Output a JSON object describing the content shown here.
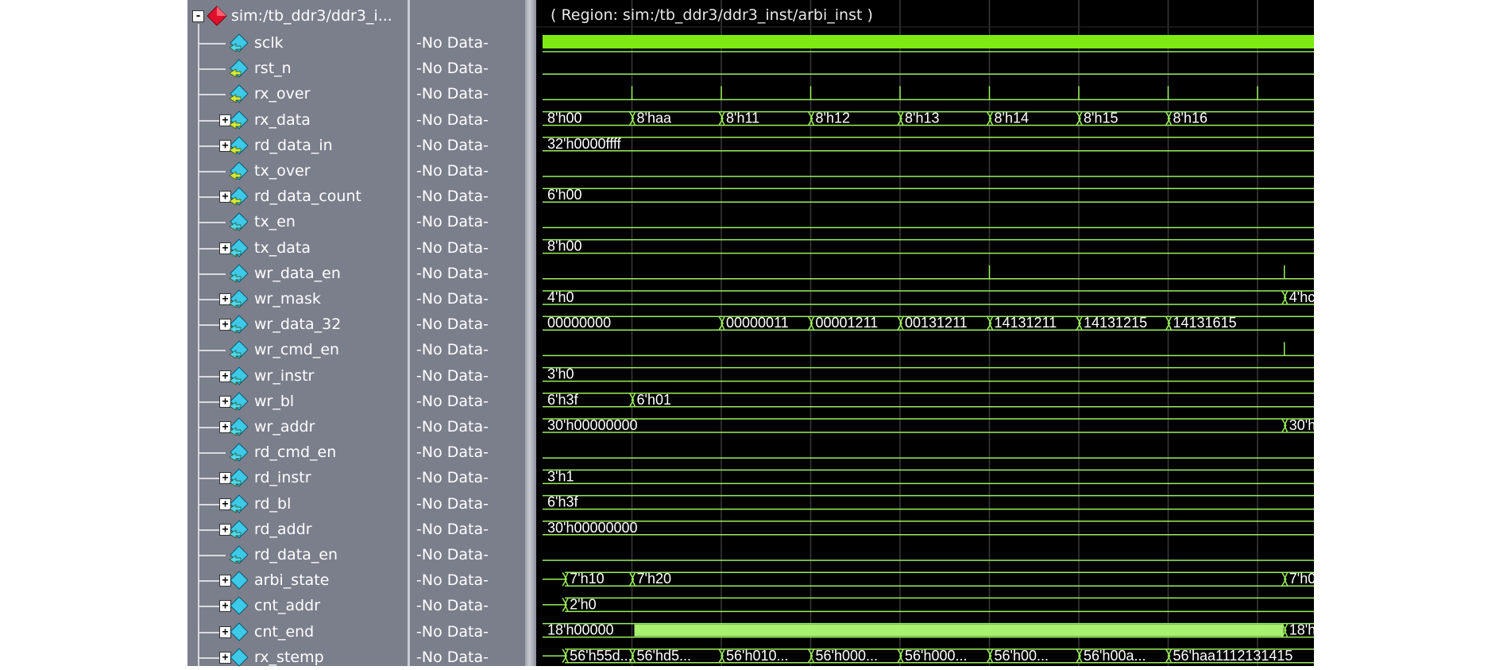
{
  "region_label": "( Region: sim:/tb_ddr3/ddr3_inst/arbi_inst )",
  "root": {
    "label": "sim:/tb_ddr3/ddr3_i...",
    "expander": "-"
  },
  "no_data": "-No Data-",
  "signals": [
    {
      "name": "sclk",
      "bus": false,
      "icon": "cyan"
    },
    {
      "name": "rst_n",
      "bus": false,
      "icon": "yellow-green"
    },
    {
      "name": "rx_over",
      "bus": false,
      "icon": "yellow-green"
    },
    {
      "name": "rx_data",
      "bus": true,
      "icon": "yellow-green"
    },
    {
      "name": "rd_data_in",
      "bus": true,
      "icon": "yellow-green"
    },
    {
      "name": "tx_over",
      "bus": false,
      "icon": "yellow-green"
    },
    {
      "name": "rd_data_count",
      "bus": true,
      "icon": "yellow-green"
    },
    {
      "name": "tx_en",
      "bus": false,
      "icon": "cyan"
    },
    {
      "name": "tx_data",
      "bus": true,
      "icon": "cyan"
    },
    {
      "name": "wr_data_en",
      "bus": false,
      "icon": "cyan"
    },
    {
      "name": "wr_mask",
      "bus": true,
      "icon": "cyan"
    },
    {
      "name": "wr_data_32",
      "bus": true,
      "icon": "cyan"
    },
    {
      "name": "wr_cmd_en",
      "bus": false,
      "icon": "cyan"
    },
    {
      "name": "wr_instr",
      "bus": true,
      "icon": "cyan"
    },
    {
      "name": "wr_bl",
      "bus": true,
      "icon": "cyan"
    },
    {
      "name": "wr_addr",
      "bus": true,
      "icon": "cyan"
    },
    {
      "name": "rd_cmd_en",
      "bus": false,
      "icon": "cyan"
    },
    {
      "name": "rd_instr",
      "bus": true,
      "icon": "cyan"
    },
    {
      "name": "rd_bl",
      "bus": true,
      "icon": "cyan"
    },
    {
      "name": "rd_addr",
      "bus": true,
      "icon": "cyan"
    },
    {
      "name": "rd_data_en",
      "bus": false,
      "icon": "cyan"
    },
    {
      "name": "arbi_state",
      "bus": true,
      "icon": "plain-cyan"
    },
    {
      "name": "cnt_addr",
      "bus": true,
      "icon": "plain-cyan"
    },
    {
      "name": "cnt_end",
      "bus": true,
      "icon": "plain-cyan"
    },
    {
      "name": "rx_stemp",
      "bus": true,
      "icon": "plain-cyan"
    }
  ],
  "waves": [
    {
      "kind": "clock"
    },
    {
      "kind": "flat"
    },
    {
      "kind": "pulses",
      "pulses": [
        1,
        2,
        3,
        4,
        5,
        6,
        7,
        8
      ]
    },
    {
      "kind": "bus",
      "segs": [
        [
          0,
          "8'h00"
        ],
        [
          1,
          "8'haa"
        ],
        [
          2,
          "8'h11"
        ],
        [
          3,
          "8'h12"
        ],
        [
          4,
          "8'h13"
        ],
        [
          5,
          "8'h14"
        ],
        [
          6,
          "8'h15"
        ],
        [
          7,
          "8'h16"
        ]
      ]
    },
    {
      "kind": "bus",
      "segs": [
        [
          0,
          "32'h0000ffff"
        ]
      ]
    },
    {
      "kind": "flat"
    },
    {
      "kind": "bus",
      "segs": [
        [
          0,
          "6'h00"
        ]
      ]
    },
    {
      "kind": "flat"
    },
    {
      "kind": "bus",
      "segs": [
        [
          0,
          "8'h00"
        ]
      ]
    },
    {
      "kind": "pulses",
      "pulses": [
        5,
        8.3
      ]
    },
    {
      "kind": "bus",
      "segs": [
        [
          0,
          "4'h0"
        ],
        [
          8.3,
          "4'hc"
        ]
      ]
    },
    {
      "kind": "bus",
      "segs": [
        [
          0,
          "00000000"
        ],
        [
          2,
          "00000011"
        ],
        [
          3,
          "00001211"
        ],
        [
          4,
          "00131211"
        ],
        [
          5,
          "14131211"
        ],
        [
          6,
          "14131215"
        ],
        [
          7,
          "14131615"
        ]
      ]
    },
    {
      "kind": "pulses",
      "pulses": [
        8.3
      ]
    },
    {
      "kind": "bus",
      "segs": [
        [
          0,
          "3'h0"
        ]
      ]
    },
    {
      "kind": "bus",
      "segs": [
        [
          0,
          "6'h3f"
        ],
        [
          1,
          "6'h01"
        ]
      ]
    },
    {
      "kind": "bus",
      "segs": [
        [
          0,
          "30'h00000000"
        ],
        [
          8.3,
          "30'h"
        ]
      ]
    },
    {
      "kind": "flat"
    },
    {
      "kind": "bus",
      "segs": [
        [
          0,
          "3'h1"
        ]
      ]
    },
    {
      "kind": "bus",
      "segs": [
        [
          0,
          "6'h3f"
        ]
      ]
    },
    {
      "kind": "bus",
      "segs": [
        [
          0,
          "30'h00000000"
        ]
      ]
    },
    {
      "kind": "flat"
    },
    {
      "kind": "bus",
      "segs": [
        [
          0.25,
          "7'h10"
        ],
        [
          1,
          "7'h20"
        ],
        [
          8.3,
          "7'h0"
        ]
      ]
    },
    {
      "kind": "bus",
      "segs": [
        [
          0.25,
          "2'h0"
        ]
      ]
    },
    {
      "kind": "fillbus",
      "segs": [
        [
          0,
          "18'h00000"
        ],
        [
          8.3,
          "18'h"
        ]
      ],
      "fill": [
        1,
        8.3
      ]
    },
    {
      "kind": "bus",
      "segs": [
        [
          0.25,
          "56'h55d..."
        ],
        [
          1,
          "56'hd5..."
        ],
        [
          2,
          "56'h010..."
        ],
        [
          3,
          "56'h000..."
        ],
        [
          4,
          "56'h000..."
        ],
        [
          5,
          "56'h00..."
        ],
        [
          6,
          "56'h00a..."
        ],
        [
          7,
          "56'haa1112131415"
        ]
      ]
    }
  ],
  "colors": {
    "wave": "#9bf05a",
    "clock_fill": "#7dea14",
    "bus_fill": "#a8f070",
    "text": "#ffffff",
    "grid": "#3a3a3a"
  }
}
